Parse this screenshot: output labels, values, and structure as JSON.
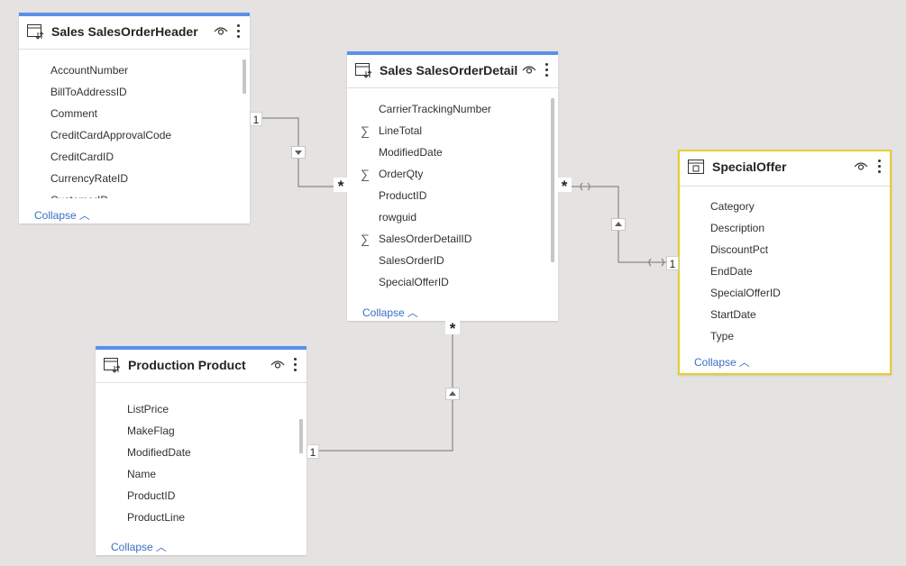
{
  "tables": {
    "header": {
      "title": "Sales SalesOrderHeader",
      "fields": [
        "AccountNumber",
        "BillToAddressID",
        "Comment",
        "CreditCardApprovalCode",
        "CreditCardID",
        "CurrencyRateID",
        "CustomerID"
      ],
      "collapse": "Collapse"
    },
    "detail": {
      "title": "Sales SalesOrderDetail",
      "fields": [
        "CarrierTrackingNumber",
        "LineTotal",
        "ModifiedDate",
        "OrderQty",
        "ProductID",
        "rowguid",
        "SalesOrderDetailID",
        "SalesOrderID",
        "SpecialOfferID"
      ],
      "collapse": "Collapse"
    },
    "offer": {
      "title": "SpecialOffer",
      "fields": [
        "Category",
        "Description",
        "DiscountPct",
        "EndDate",
        "SpecialOfferID",
        "StartDate",
        "Type"
      ],
      "collapse": "Collapse"
    },
    "product": {
      "title": "Production Product",
      "fields": [
        "ListPrice",
        "MakeFlag",
        "ModifiedDate",
        "Name",
        "ProductID",
        "ProductLine"
      ],
      "collapse": "Collapse"
    }
  },
  "relationships": {
    "one": "1",
    "many": "*"
  },
  "colors": {
    "canvas": "#e4e3e1",
    "card_accent": "#5b8fe8",
    "selected_border": "#e7cc2d",
    "link": "#3a6fc4"
  },
  "icons": {
    "table": "table-icon",
    "view": "eye-icon",
    "more": "more-options-icon",
    "measure": "sigma-icon"
  }
}
